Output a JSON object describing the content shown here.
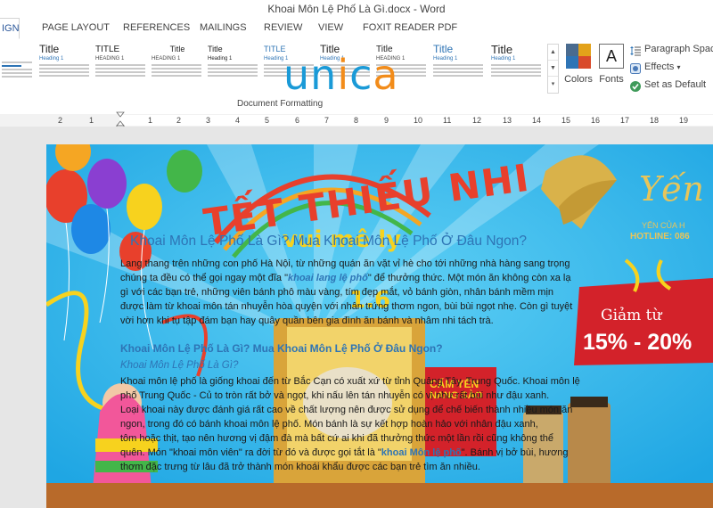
{
  "title_bar": {
    "document_title": "Khoai Môn Lệ Phố Là Gì.docx - Word"
  },
  "tabs": [
    {
      "label": "IGN",
      "active": true
    },
    {
      "label": "PAGE LAYOUT"
    },
    {
      "label": "REFERENCES"
    },
    {
      "label": "MAILINGS"
    },
    {
      "label": "REVIEW"
    },
    {
      "label": "VIEW"
    },
    {
      "label": "FOXIT READER PDF"
    }
  ],
  "ribbon": {
    "style_gallery": [
      {
        "title": "",
        "heading": ""
      },
      {
        "title": "Title",
        "heading": "Heading 1"
      },
      {
        "title": "TITLE",
        "heading": "HEADING 1"
      },
      {
        "title": "Title",
        "heading": "HEADING 1"
      },
      {
        "title": "Title",
        "heading": "Heading 1"
      },
      {
        "title": "TITLE",
        "heading": "Heading 1"
      },
      {
        "title": "Title",
        "heading": "Heading 1"
      },
      {
        "title": "Title",
        "heading": "HEADING 1"
      },
      {
        "title": "Title",
        "heading": "Heading 1"
      },
      {
        "title": "Title",
        "heading": "Heading 1"
      }
    ],
    "colors_label": "Colors",
    "fonts_label": "Fonts",
    "fonts_glyph": "A",
    "paragraph_spacing_label": "Paragraph Spaci",
    "effects_label": "Effects",
    "set_default_label": "Set as Default",
    "group_label": "Document Formatting",
    "watermark_logo": {
      "letters": [
        "u",
        "n",
        "i",
        "c",
        "a"
      ]
    },
    "icons": [
      "paragraph-spacing-icon",
      "effects-icon",
      "check-icon",
      "gallery-more-icon"
    ]
  },
  "ruler": {
    "numbers": [
      "2",
      "1",
      "1",
      "2",
      "3",
      "4",
      "5",
      "6",
      "7",
      "8",
      "9",
      "10",
      "11",
      "12",
      "13",
      "14",
      "15",
      "16",
      "17",
      "18",
      "19"
    ]
  },
  "document": {
    "heading1": "Khoai Môn Lệ Phố Là Gì? Mua Khoai Môn Lệ Phố Ở Đâu Ngon?",
    "para1": [
      {
        "text": "Lang thang trên những con phố Hà Nội, từ những quán ăn vặt vỉ hè cho tới những nhà hàng sang trọng"
      },
      {
        "pre": "chúng ta đều có thể gọi ngay một đĩa \"",
        "em": "khoai lang lệ phố",
        "post": "\" để thưởng thức. Một món ăn không còn xa lạ"
      },
      {
        "text": "gì với các bạn trẻ, những viên bánh phô màu vàng, tím đẹp mắt, vỏ bánh giòn, nhân bánh mềm mịn"
      },
      {
        "text": "được làm từ khoai môn tán nhuyễn hòa quyện với nhân trứng thơm ngon, bùi bùi ngọt nhẹ. Còn gì tuyệt"
      },
      {
        "text": "vời hơn khi tụ tập đám bạn hay quây quần bên gia đình ăn bánh và nhâm nhi tách trà."
      }
    ],
    "heading2": "Khoai Môn Lệ Phố Là Gì? Mua Khoai Môn Lệ Phố Ở Đâu Ngon?",
    "heading3": "Khoai Môn Lệ Phố Là Gì?",
    "para2": [
      {
        "text": "Khoai môn lệ phố là giống khoai đến từ Bắc Cạn có xuất xứ từ tỉnh Quảng Tây, Trung Quốc. Khoai môn lệ"
      },
      {
        "text": "phố Trung Quốc - Củ to tròn rất bở và ngọt, khi nấu lên tán nhuyễn có vị như rất bùi như đậu xanh."
      },
      {
        "text": "Loại khoai này được đánh giá rất cao về chất lượng nên được sử dụng để chế biến thành nhiều món ăn"
      },
      {
        "text": "ngon, trong đó có bánh khoai môn lệ phố. Món bánh là sự kết hợp hoàn hảo với nhân đậu xanh,"
      },
      {
        "text": "tôm hoặc thịt, tạo nên hương vị đậm đà mà bất cứ ai khi đã thưởng thức một lần rồi cũng không thể"
      },
      {
        "pre": "quên. Món \"khoai môn viên\" ra đời từ đó và được gọi tắt là \"",
        "em": "khoai Môn lệ phố",
        "post": "\". Bánh vị bở bùi, hương"
      },
      {
        "text": "thơm đặc trưng từ lâu đã trở thành món khoái khẩu được các bạn trẻ tìm ăn nhiều."
      }
    ],
    "banner": {
      "headline": "TẾT THIẾU NHI",
      "subtitle": "vui mê ly",
      "date": "1.6",
      "brand_script": "Yến",
      "brand_line": "YẾN CỦA H",
      "hotline": "HOTLINE: 086",
      "promo_top": "Giảm từ",
      "promo_bottom": "15% - 20%",
      "product_label_top": "CẨM YẾN",
      "product_label_mid": "NANG SÀO"
    }
  }
}
